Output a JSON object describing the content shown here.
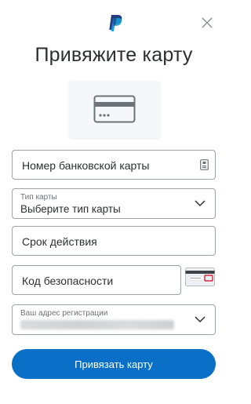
{
  "header": {
    "logo_icon": "paypal-logo-icon",
    "close_icon": "close-icon",
    "title": "Привяжите карту"
  },
  "illustration": {
    "icon": "credit-card-icon"
  },
  "form": {
    "card_number": {
      "placeholder": "Номер банковской карты",
      "icon": "card-id-icon"
    },
    "card_type": {
      "label": "Тип карты",
      "value": "Выберите тип карты",
      "icon": "chevron-down-icon"
    },
    "expiry": {
      "placeholder": "Срок действия"
    },
    "security_code": {
      "placeholder": "Код безопасности",
      "hint_icon": "card-back-cvv-icon"
    },
    "address": {
      "label": "Ваш адрес регистрации",
      "icon": "chevron-down-icon"
    }
  },
  "submit_label": "Привязать карту",
  "colors": {
    "accent": "#0a6fc7",
    "border": "#9da3a6",
    "text": "#2c2e2f"
  }
}
